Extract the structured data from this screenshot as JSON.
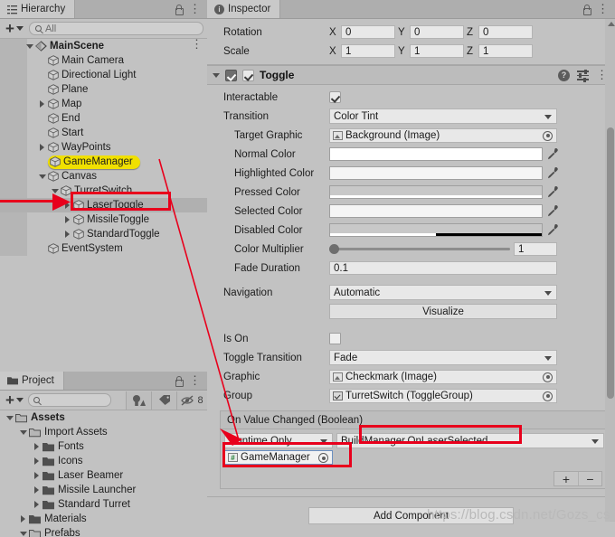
{
  "hierarchy": {
    "tab_label": "Hierarchy",
    "search_placeholder": "All",
    "add_label": "+",
    "items": [
      {
        "label": "MainScene",
        "depth": 0,
        "icon": "scene-icon",
        "foldout": "open",
        "bold": true,
        "selected": false,
        "highlight": false,
        "kebab": true
      },
      {
        "label": "Main Camera",
        "depth": 1,
        "icon": "gameobject-icon",
        "foldout": "none",
        "bold": false,
        "selected": false,
        "highlight": false,
        "kebab": false
      },
      {
        "label": "Directional Light",
        "depth": 1,
        "icon": "gameobject-icon",
        "foldout": "none",
        "bold": false,
        "selected": false,
        "highlight": false,
        "kebab": false
      },
      {
        "label": "Plane",
        "depth": 1,
        "icon": "gameobject-icon",
        "foldout": "none",
        "bold": false,
        "selected": false,
        "highlight": false,
        "kebab": false
      },
      {
        "label": "Map",
        "depth": 1,
        "icon": "gameobject-icon",
        "foldout": "closed",
        "bold": false,
        "selected": false,
        "highlight": false,
        "kebab": false
      },
      {
        "label": "End",
        "depth": 1,
        "icon": "gameobject-icon",
        "foldout": "none",
        "bold": false,
        "selected": false,
        "highlight": false,
        "kebab": false
      },
      {
        "label": "Start",
        "depth": 1,
        "icon": "gameobject-icon",
        "foldout": "none",
        "bold": false,
        "selected": false,
        "highlight": false,
        "kebab": false
      },
      {
        "label": "WayPoints",
        "depth": 1,
        "icon": "gameobject-icon",
        "foldout": "closed",
        "bold": false,
        "selected": false,
        "highlight": false,
        "kebab": false
      },
      {
        "label": "GameManager",
        "depth": 1,
        "icon": "gameobject-icon",
        "foldout": "none",
        "bold": false,
        "selected": false,
        "highlight": true,
        "kebab": false
      },
      {
        "label": "Canvas",
        "depth": 1,
        "icon": "gameobject-icon",
        "foldout": "open",
        "bold": false,
        "selected": false,
        "highlight": false,
        "kebab": false
      },
      {
        "label": "TurretSwitch",
        "depth": 2,
        "icon": "gameobject-icon",
        "foldout": "open",
        "bold": false,
        "selected": false,
        "highlight": false,
        "kebab": false
      },
      {
        "label": "LaserToggle",
        "depth": 3,
        "icon": "gameobject-icon",
        "foldout": "closed",
        "bold": false,
        "selected": true,
        "highlight": false,
        "kebab": false
      },
      {
        "label": "MissileToggle",
        "depth": 3,
        "icon": "gameobject-icon",
        "foldout": "closed",
        "bold": false,
        "selected": false,
        "highlight": false,
        "kebab": false
      },
      {
        "label": "StandardToggle",
        "depth": 3,
        "icon": "gameobject-icon",
        "foldout": "closed",
        "bold": false,
        "selected": false,
        "highlight": false,
        "kebab": false
      },
      {
        "label": "EventSystem",
        "depth": 1,
        "icon": "gameobject-icon",
        "foldout": "none",
        "bold": false,
        "selected": false,
        "highlight": false,
        "kebab": false
      }
    ]
  },
  "project": {
    "tab_label": "Project",
    "search_placeholder": "",
    "hidden_count": "8",
    "items": [
      {
        "label": "Assets",
        "depth": 0,
        "foldout": "open",
        "bold": true,
        "folder": "open"
      },
      {
        "label": "Import Assets",
        "depth": 1,
        "foldout": "open",
        "bold": false,
        "folder": "open"
      },
      {
        "label": "Fonts",
        "depth": 2,
        "foldout": "closed",
        "bold": false,
        "folder": "closed"
      },
      {
        "label": "Icons",
        "depth": 2,
        "foldout": "closed",
        "bold": false,
        "folder": "closed"
      },
      {
        "label": "Laser Beamer",
        "depth": 2,
        "foldout": "closed",
        "bold": false,
        "folder": "closed"
      },
      {
        "label": "Missile Launcher",
        "depth": 2,
        "foldout": "closed",
        "bold": false,
        "folder": "closed"
      },
      {
        "label": "Standard Turret",
        "depth": 2,
        "foldout": "closed",
        "bold": false,
        "folder": "closed"
      },
      {
        "label": "Materials",
        "depth": 1,
        "foldout": "closed",
        "bold": false,
        "folder": "closed"
      },
      {
        "label": "Prefabs",
        "depth": 1,
        "foldout": "open",
        "bold": false,
        "folder": "open"
      }
    ]
  },
  "inspector": {
    "tab_label": "Inspector",
    "transform": {
      "rows": [
        {
          "label": "Rotation",
          "x": "0",
          "y": "0",
          "z": "0"
        },
        {
          "label": "Scale",
          "x": "1",
          "y": "1",
          "z": "1"
        }
      ],
      "axis_labels": [
        "X",
        "Y",
        "Z"
      ]
    },
    "component": {
      "title": "Toggle",
      "enabled": true,
      "help_glyph": "?",
      "fields": {
        "interactable_label": "Interactable",
        "interactable_checked": true,
        "transition_label": "Transition",
        "transition_value": "Color Tint",
        "target_graphic_label": "Target Graphic",
        "target_graphic_value": "Background (Image)",
        "normal_color_label": "Normal Color",
        "normal_color_value": "#FFFFFF",
        "highlighted_color_label": "Highlighted Color",
        "highlighted_color_value": "#F5F5F5",
        "pressed_color_label": "Pressed Color",
        "pressed_color_value": "#C8C8C8",
        "selected_color_label": "Selected Color",
        "selected_color_value": "#F5F5F5",
        "disabled_color_label": "Disabled Color",
        "disabled_color_value": "#C8C8C8",
        "color_multiplier_label": "Color Multiplier",
        "color_multiplier_value": "1",
        "fade_duration_label": "Fade Duration",
        "fade_duration_value": "0.1",
        "navigation_label": "Navigation",
        "navigation_value": "Automatic",
        "visualize_label": "Visualize",
        "is_on_label": "Is On",
        "is_on_checked": false,
        "toggle_transition_label": "Toggle Transition",
        "toggle_transition_value": "Fade",
        "graphic_label": "Graphic",
        "graphic_value": "Checkmark (Image)",
        "group_label": "Group",
        "group_value": "TurretSwitch (ToggleGroup)"
      },
      "event": {
        "header": "On Value Changed (Boolean)",
        "mode": "Runtime Only",
        "function": "BuildManager.OnLaserSelected",
        "object": "GameManager",
        "add_label": "+",
        "remove_label": "−"
      }
    },
    "add_component_label": "Add Component"
  },
  "annotations": {
    "watermark": "https://blog.csdn.net/Gozs_cs_dn",
    "highlight_color": "#E8001C",
    "gamemanager_highlight_color": "#F0E000"
  }
}
